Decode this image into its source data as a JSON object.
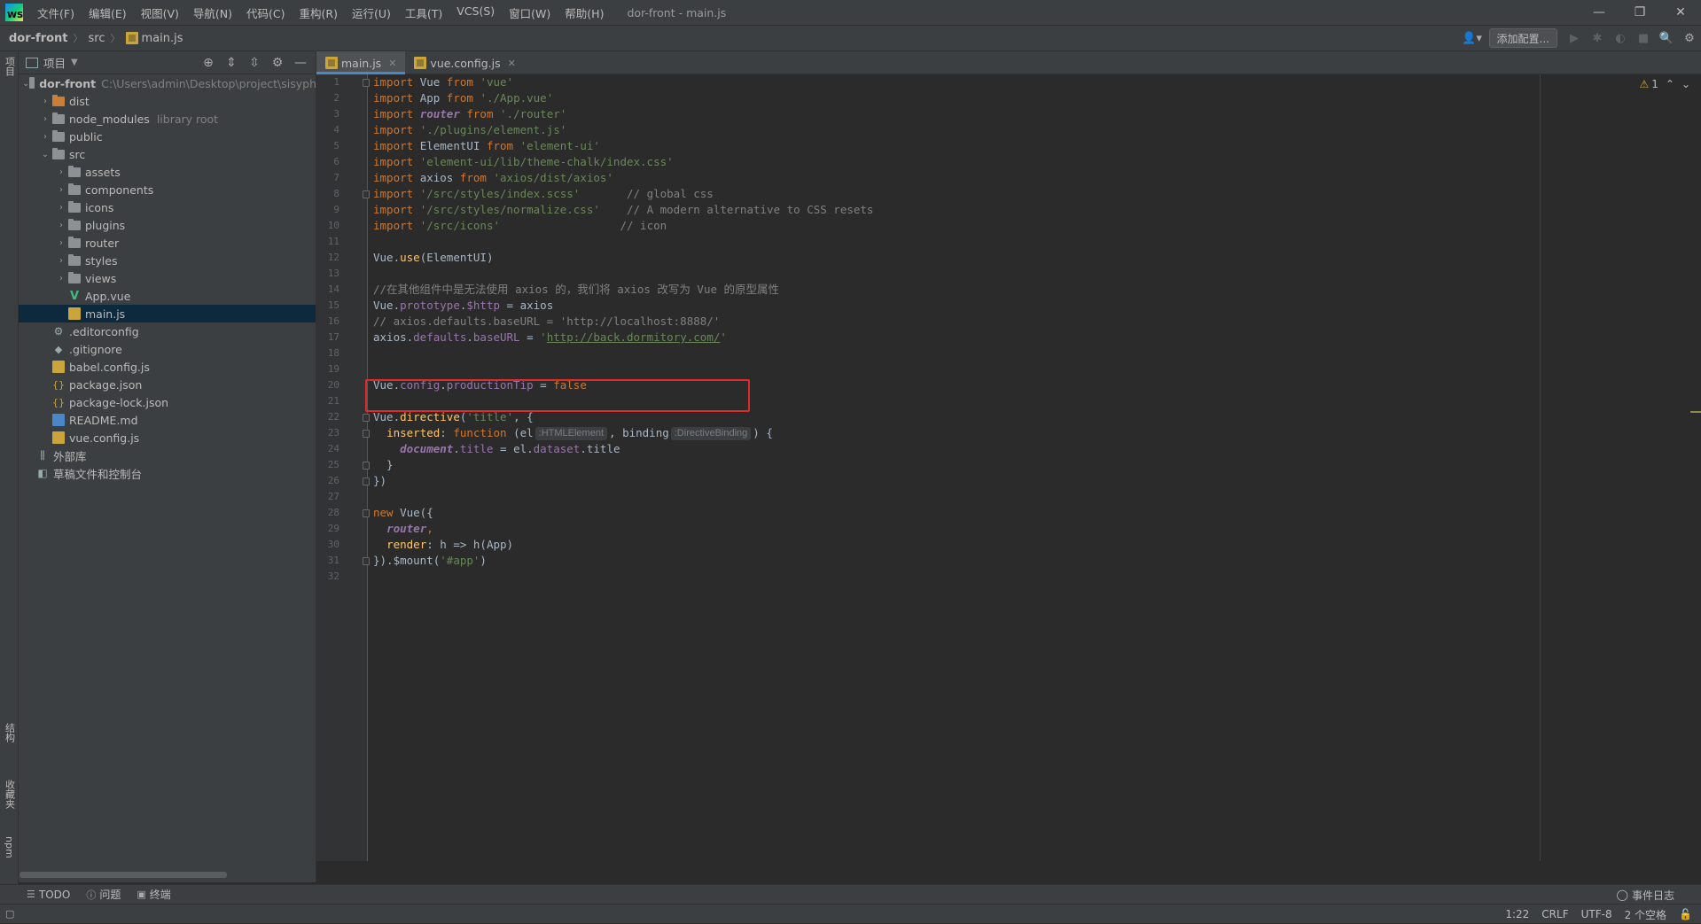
{
  "app": {
    "logo_text": "WS",
    "window_title": "dor-front - main.js",
    "menu": [
      "文件(F)",
      "编辑(E)",
      "视图(V)",
      "导航(N)",
      "代码(C)",
      "重构(R)",
      "运行(U)",
      "工具(T)",
      "VCS(S)",
      "窗口(W)",
      "帮助(H)"
    ]
  },
  "navbar": {
    "crumbs": [
      "dor-front",
      "src",
      "main.js"
    ],
    "add_config_label": "添加配置..."
  },
  "left_strip": {
    "project_tab": "项目",
    "structure_tab": "结构",
    "favorites_tab": "收藏夹",
    "npm_tab": "npm"
  },
  "project_panel": {
    "title": "项目",
    "root_name": "dor-front",
    "root_path": "C:\\Users\\admin\\Desktop\\project\\sisyph",
    "items": [
      {
        "name": "dist",
        "type": "folder-orange",
        "depth": 1,
        "arrow": "›"
      },
      {
        "name": "node_modules",
        "type": "folder",
        "depth": 1,
        "arrow": "›",
        "note": "library root"
      },
      {
        "name": "public",
        "type": "folder",
        "depth": 1,
        "arrow": "›"
      },
      {
        "name": "src",
        "type": "folder",
        "depth": 1,
        "arrow": "⌄"
      },
      {
        "name": "assets",
        "type": "folder",
        "depth": 2,
        "arrow": "›"
      },
      {
        "name": "components",
        "type": "folder",
        "depth": 2,
        "arrow": "›"
      },
      {
        "name": "icons",
        "type": "folder",
        "depth": 2,
        "arrow": "›"
      },
      {
        "name": "plugins",
        "type": "folder",
        "depth": 2,
        "arrow": "›"
      },
      {
        "name": "router",
        "type": "folder",
        "depth": 2,
        "arrow": "›"
      },
      {
        "name": "styles",
        "type": "folder",
        "depth": 2,
        "arrow": "›"
      },
      {
        "name": "views",
        "type": "folder",
        "depth": 2,
        "arrow": "›"
      },
      {
        "name": "App.vue",
        "type": "vue",
        "depth": 2
      },
      {
        "name": "main.js",
        "type": "js",
        "depth": 2,
        "selected": true
      },
      {
        "name": ".editorconfig",
        "type": "gear",
        "depth": 1
      },
      {
        "name": ".gitignore",
        "type": "git",
        "depth": 1
      },
      {
        "name": "babel.config.js",
        "type": "js",
        "depth": 1
      },
      {
        "name": "package.json",
        "type": "json",
        "depth": 1
      },
      {
        "name": "package-lock.json",
        "type": "json",
        "depth": 1
      },
      {
        "name": "README.md",
        "type": "md",
        "depth": 1
      },
      {
        "name": "vue.config.js",
        "type": "js",
        "depth": 1
      },
      {
        "name": "外部库",
        "type": "lib",
        "depth": 0
      },
      {
        "name": "草稿文件和控制台",
        "type": "scratch",
        "depth": 0
      }
    ]
  },
  "editor_tabs": [
    {
      "label": "main.js",
      "active": true
    },
    {
      "label": "vue.config.js",
      "active": false
    }
  ],
  "inspection": {
    "warnings": "1"
  },
  "code_lines": [
    [
      [
        "kw",
        "import "
      ],
      [
        "",
        "Vue "
      ],
      [
        "kw",
        "from "
      ],
      [
        "str",
        "'vue'"
      ]
    ],
    [
      [
        "kw",
        "import "
      ],
      [
        "",
        "App "
      ],
      [
        "kw",
        "from "
      ],
      [
        "str",
        "'./App.vue'"
      ]
    ],
    [
      [
        "kw",
        "import "
      ],
      [
        "it-kw",
        "router "
      ],
      [
        "kw",
        "from "
      ],
      [
        "str",
        "'./router'"
      ]
    ],
    [
      [
        "kw",
        "import "
      ],
      [
        "str",
        "'./plugins/element.js'"
      ]
    ],
    [
      [
        "kw",
        "import "
      ],
      [
        "",
        "ElementUI "
      ],
      [
        "kw",
        "from "
      ],
      [
        "str",
        "'element-ui'"
      ]
    ],
    [
      [
        "kw",
        "import "
      ],
      [
        "str",
        "'element-ui/lib/theme-chalk/index.css'"
      ]
    ],
    [
      [
        "kw",
        "import "
      ],
      [
        "",
        "axios "
      ],
      [
        "kw",
        "from "
      ],
      [
        "str",
        "'axios/dist/axios'"
      ]
    ],
    [
      [
        "kw",
        "import "
      ],
      [
        "str",
        "'/src/styles/index.scss'"
      ],
      [
        "",
        "       "
      ],
      [
        "cmt",
        "// global css"
      ]
    ],
    [
      [
        "kw",
        "import "
      ],
      [
        "str",
        "'/src/styles/normalize.css'"
      ],
      [
        "",
        "    "
      ],
      [
        "cmt",
        "// A modern alternative to CSS resets"
      ]
    ],
    [
      [
        "kw",
        "import "
      ],
      [
        "str",
        "'/src/icons'"
      ],
      [
        "",
        "                  "
      ],
      [
        "cmt",
        "// icon"
      ]
    ],
    [],
    [
      [
        "",
        "Vue."
      ],
      [
        "fn",
        "use"
      ],
      [
        "",
        "(ElementUI)"
      ]
    ],
    [],
    [
      [
        "cmt",
        "//在其他组件中是无法使用 axios 的，我们将 axios 改写为 Vue 的原型属性"
      ]
    ],
    [
      [
        "",
        "Vue."
      ],
      [
        "prop",
        "prototype"
      ],
      [
        "",
        "."
      ],
      [
        "prop",
        "$http"
      ],
      [
        "",
        " = axios"
      ]
    ],
    [
      [
        "cmt",
        "// axios.defaults.baseURL = 'http://localhost:8888/'"
      ]
    ],
    [
      [
        "",
        "axios."
      ],
      [
        "prop",
        "defaults"
      ],
      [
        "",
        "."
      ],
      [
        "prop",
        "baseURL"
      ],
      [
        "",
        " = "
      ],
      [
        "str",
        "'"
      ],
      [
        "url",
        "http://back.dormitory.com/"
      ],
      [
        "str",
        "'"
      ]
    ],
    [],
    [],
    [
      [
        "",
        "Vue."
      ],
      [
        "prop",
        "config"
      ],
      [
        "",
        "."
      ],
      [
        "prop",
        "productionTip"
      ],
      [
        "",
        " = "
      ],
      [
        "kw",
        "false"
      ]
    ],
    [],
    [
      [
        "",
        "Vue."
      ],
      [
        "fn",
        "directive"
      ],
      [
        "",
        "("
      ],
      [
        "str",
        "'title'"
      ],
      [
        "",
        ", {"
      ]
    ],
    [
      [
        "",
        "  "
      ],
      [
        "fn",
        "inserted"
      ],
      [
        "",
        ": "
      ],
      [
        "kw",
        "function "
      ],
      [
        "",
        "(el"
      ],
      [
        "hint",
        ":HTMLElement"
      ],
      [
        "",
        ", binding"
      ],
      [
        "hint",
        ":DirectiveBinding"
      ],
      [
        "",
        ") {"
      ]
    ],
    [
      [
        "",
        "    "
      ],
      [
        "it-kw",
        "document"
      ],
      [
        "",
        "."
      ],
      [
        "prop",
        "title"
      ],
      [
        "",
        " = el."
      ],
      [
        "prop",
        "dataset"
      ],
      [
        "",
        ".title"
      ]
    ],
    [
      [
        "",
        "  }"
      ]
    ],
    [
      [
        "",
        "})"
      ]
    ],
    [],
    [
      [
        "kw",
        "new "
      ],
      [
        "",
        "Vue({"
      ]
    ],
    [
      [
        "",
        "  "
      ],
      [
        "it-kw",
        "router"
      ],
      [
        "kw",
        ","
      ]
    ],
    [
      [
        "",
        "  "
      ],
      [
        "fn",
        "render"
      ],
      [
        "",
        ": h => h(App)"
      ]
    ],
    [
      [
        "",
        "}).$mount("
      ],
      [
        "str",
        "'#app'"
      ],
      [
        "",
        ")"
      ]
    ],
    []
  ],
  "line_numbers": [
    "1",
    "2",
    "3",
    "4",
    "5",
    "6",
    "7",
    "8",
    "9",
    "10",
    "11",
    "12",
    "13",
    "14",
    "15",
    "16",
    "17",
    "18",
    "19",
    "20",
    "21",
    "22",
    "23",
    "24",
    "25",
    "26",
    "27",
    "28",
    "29",
    "30",
    "31",
    "32"
  ],
  "bottom_tools": {
    "todo": "TODO",
    "problems": "问题",
    "terminal": "终端",
    "event_log": "事件日志"
  },
  "status": {
    "position": "1:22",
    "line_sep": "CRLF",
    "encoding": "UTF-8",
    "indent": "2 个空格"
  }
}
